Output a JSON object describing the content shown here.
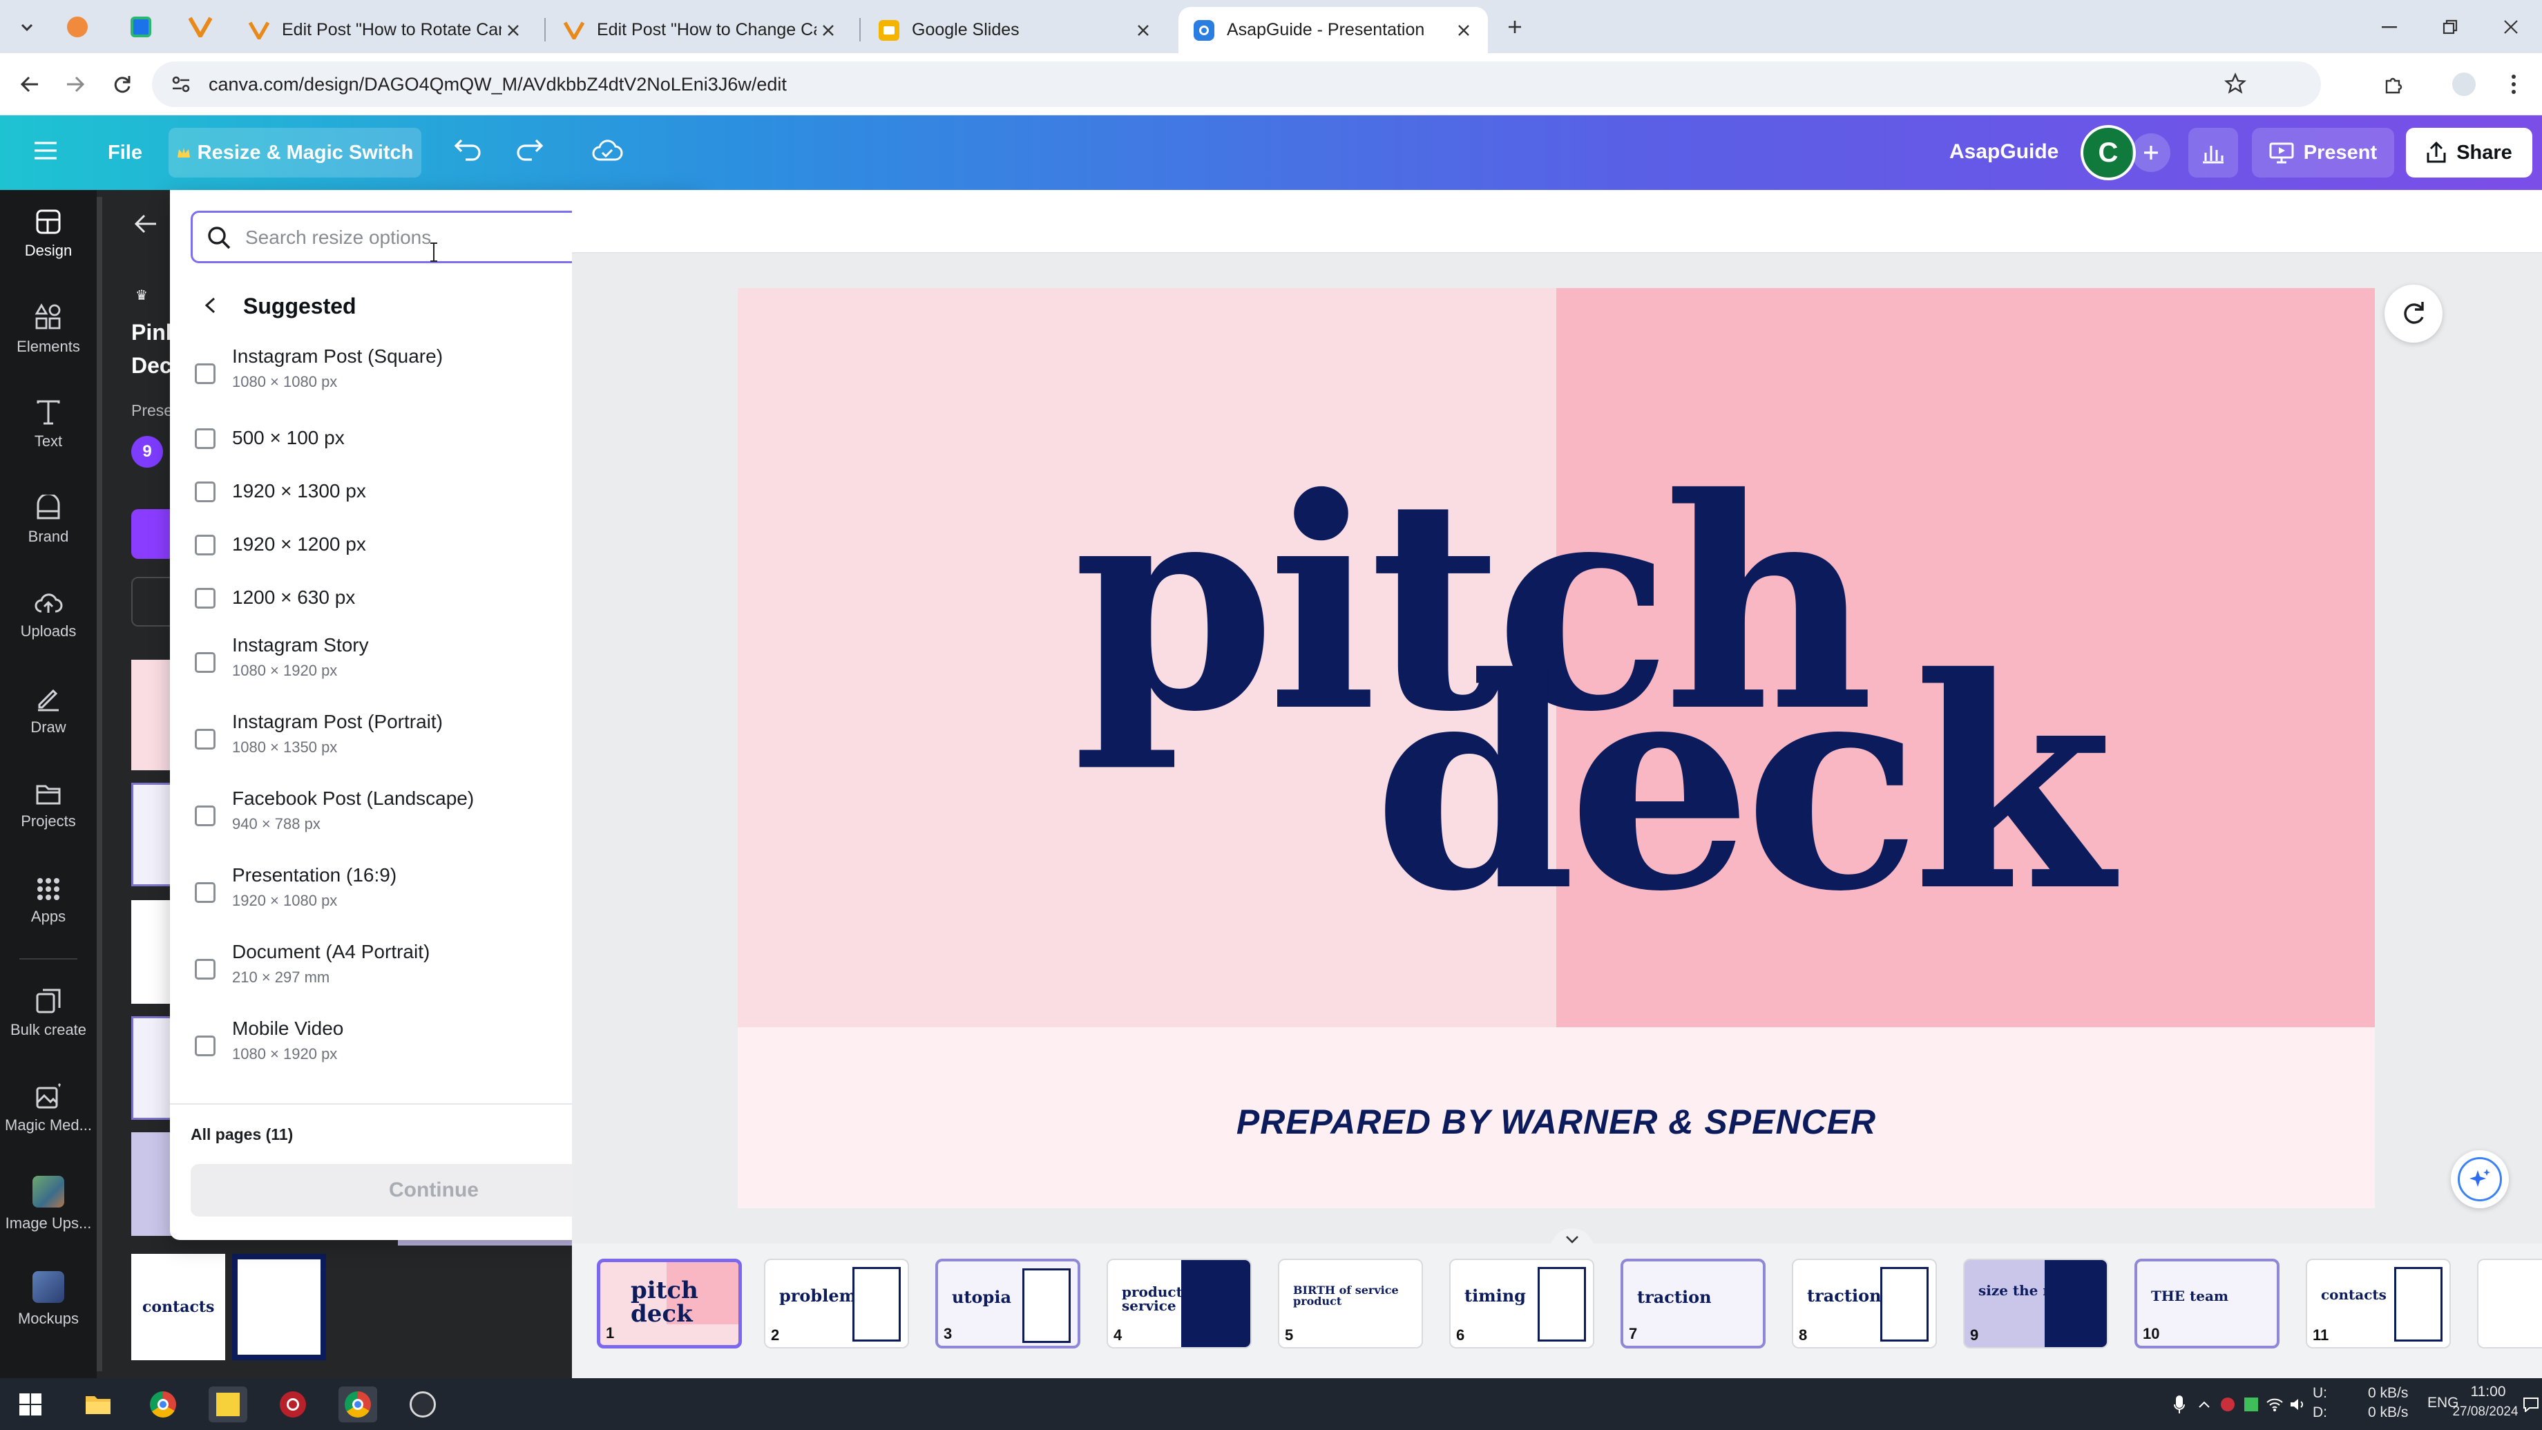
{
  "browser": {
    "tabs": [
      {
        "title": "Edit Post \"How to Rotate Canva"
      },
      {
        "title": "Edit Post \"How to Change Canv"
      },
      {
        "title": "Google Slides"
      },
      {
        "title": "AsapGuide - Presentation"
      }
    ],
    "url": "canva.com/design/DAGO4QmQW_M/AVdkbbZ4dtV2NoLEni3J6w/edit"
  },
  "topbar": {
    "file_label": "File",
    "resize_label": "Resize & Magic Switch",
    "team_name": "AsapGuide",
    "avatar_initial": "C",
    "present_label": "Present",
    "share_label": "Share"
  },
  "rail": {
    "items": [
      {
        "label": "Design",
        "icon": "layout-icon"
      },
      {
        "label": "Elements",
        "icon": "shapes-icon"
      },
      {
        "label": "Text",
        "icon": "text-icon"
      },
      {
        "label": "Brand",
        "icon": "brand-icon"
      },
      {
        "label": "Uploads",
        "icon": "cloud-upload-icon"
      },
      {
        "label": "Draw",
        "icon": "pen-icon"
      },
      {
        "label": "Projects",
        "icon": "folder-icon"
      },
      {
        "label": "Apps",
        "icon": "grid-icon"
      },
      {
        "label": "Bulk create",
        "icon": "bulk-icon"
      },
      {
        "label": "Magic Med...",
        "icon": "magic-media-icon"
      },
      {
        "label": "Image Ups...",
        "icon": "image-upscaler-icon"
      },
      {
        "label": "Mockups",
        "icon": "mockups-icon"
      }
    ]
  },
  "design_panel": {
    "partial_title_1": "Pink",
    "partial_title_2": "Dec",
    "partial_sub": "Prese",
    "badge": "9"
  },
  "resize_popup": {
    "search_placeholder": "Search resize options",
    "section_title": "Suggested",
    "options": [
      {
        "name": "Instagram Post (Square)",
        "dims": "1080 × 1080 px"
      },
      {
        "name": "500 × 100 px",
        "dims": ""
      },
      {
        "name": "1920 × 1300 px",
        "dims": ""
      },
      {
        "name": "1920 × 1200 px",
        "dims": ""
      },
      {
        "name": "1200 × 630 px",
        "dims": ""
      },
      {
        "name": "Instagram Story",
        "dims": "1080 × 1920 px"
      },
      {
        "name": "Instagram Post (Portrait)",
        "dims": "1080 × 1350 px"
      },
      {
        "name": "Facebook Post (Landscape)",
        "dims": "940 × 788 px"
      },
      {
        "name": "Presentation (16:9)",
        "dims": "1920 × 1080 px"
      },
      {
        "name": "Document (A4 Portrait)",
        "dims": "210 × 297 mm"
      },
      {
        "name": "Mobile Video",
        "dims": "1080 × 1920 px"
      }
    ],
    "pages_selector": "All pages (11)",
    "continue_label": "Continue"
  },
  "slide": {
    "title_line1": "pitch",
    "title_line2": "deck",
    "subtitle": "PREPARED BY WARNER & SPENCER",
    "colors": {
      "left": "#f9dde3",
      "right": "#f8b7c3",
      "text": "#0b1b5c"
    }
  },
  "filmstrip": {
    "thumbs": [
      {
        "num": "1",
        "title": "pitch deck"
      },
      {
        "num": "2",
        "title": "problem"
      },
      {
        "num": "3",
        "title": "utopia"
      },
      {
        "num": "4",
        "title": "product of service"
      },
      {
        "num": "5",
        "title": "BIRTH of service product"
      },
      {
        "num": "6",
        "title": "timing"
      },
      {
        "num": "7",
        "title": "traction"
      },
      {
        "num": "8",
        "title": "traction"
      },
      {
        "num": "9",
        "title": "size the market"
      },
      {
        "num": "10",
        "title": "THE team"
      },
      {
        "num": "11",
        "title": "contacts"
      }
    ]
  },
  "taskbar": {
    "net_up": "U:",
    "net_down": "D:",
    "rate_up": "0 kB/s",
    "rate_down": "0 kB/s",
    "lang": "ENG",
    "time": "11:00",
    "date": "27/08/2024"
  }
}
